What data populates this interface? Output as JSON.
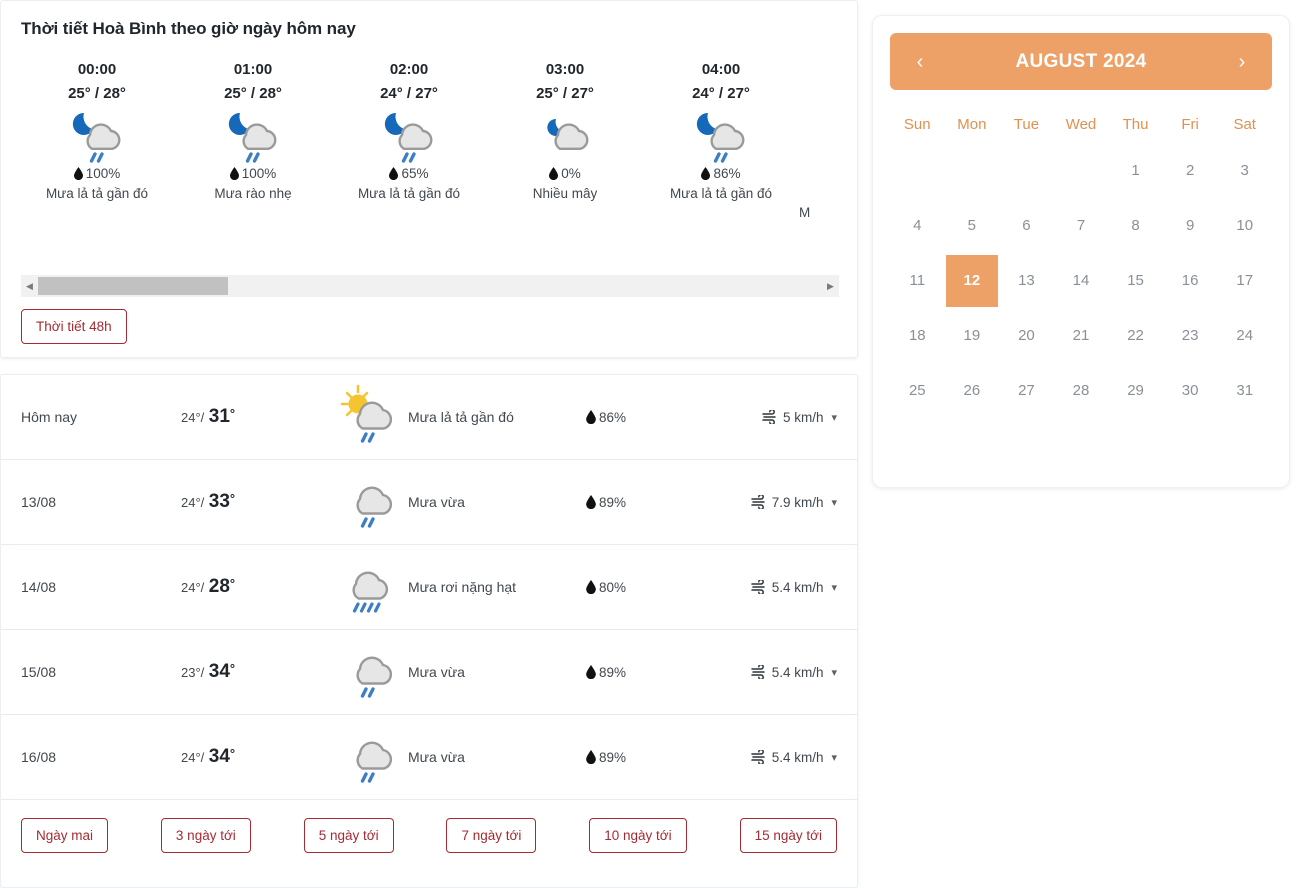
{
  "hourly": {
    "title": "Thời tiết Hoà Bình theo giờ ngày hôm nay",
    "columns": [
      {
        "time": "00:00",
        "temp": "25° / 28°",
        "pop": "100%",
        "desc": "Mưa lả tả gần đó",
        "icon": "moon-cloud-rain-icon"
      },
      {
        "time": "01:00",
        "temp": "25° / 28°",
        "pop": "100%",
        "desc": "Mưa rào nhẹ",
        "icon": "moon-cloud-rain-icon"
      },
      {
        "time": "02:00",
        "temp": "24° / 27°",
        "pop": "65%",
        "desc": "Mưa lả tả gần đó",
        "icon": "moon-cloud-rain-icon"
      },
      {
        "time": "03:00",
        "temp": "25° / 27°",
        "pop": "0%",
        "desc": "Nhiều mây",
        "icon": "moon-cloud-icon"
      },
      {
        "time": "04:00",
        "temp": "24° / 27°",
        "pop": "86%",
        "desc": "Mưa lả tả gần đó",
        "icon": "moon-cloud-rain-icon"
      }
    ],
    "cutoff_text": "M",
    "scroll": {
      "left_arrow": "◀",
      "right_arrow": "▶"
    },
    "button_48h": "Thời tiết 48h"
  },
  "daily": {
    "rows": [
      {
        "day": "Hôm nay",
        "low": "24°",
        "sep": "/",
        "high": "31",
        "deg": "°",
        "condition": "Mưa lả tả gần đó",
        "humidity": "86%",
        "wind": "5 km/h",
        "icon": "sun-cloud-rain-icon"
      },
      {
        "day": "13/08",
        "low": "24°",
        "sep": "/",
        "high": "33",
        "deg": "°",
        "condition": "Mưa vừa",
        "humidity": "89%",
        "wind": "7.9 km/h",
        "icon": "cloud-rain-icon"
      },
      {
        "day": "14/08",
        "low": "24°",
        "sep": "/",
        "high": "28",
        "deg": "°",
        "condition": "Mưa rơi nặng hạt",
        "humidity": "80%",
        "wind": "5.4 km/h",
        "icon": "cloud-heavy-rain-icon"
      },
      {
        "day": "15/08",
        "low": "23°",
        "sep": "/",
        "high": "34",
        "deg": "°",
        "condition": "Mưa vừa",
        "humidity": "89%",
        "wind": "5.4 km/h",
        "icon": "cloud-rain-icon"
      },
      {
        "day": "16/08",
        "low": "24°",
        "sep": "/",
        "high": "34",
        "deg": "°",
        "condition": "Mưa vừa",
        "humidity": "89%",
        "wind": "5.4 km/h",
        "icon": "cloud-rain-icon"
      }
    ],
    "range_buttons": [
      "Ngày mai",
      "3 ngày tới",
      "5 ngày tới",
      "7 ngày tới",
      "10 ngày tới",
      "15 ngày tới"
    ]
  },
  "calendar": {
    "title": "AUGUST 2024",
    "prev": "‹",
    "next": "›",
    "weekdays": [
      "Sun",
      "Mon",
      "Tue",
      "Wed",
      "Thu",
      "Fri",
      "Sat"
    ],
    "leading_blanks": 4,
    "days": [
      1,
      2,
      3,
      4,
      5,
      6,
      7,
      8,
      9,
      10,
      11,
      12,
      13,
      14,
      15,
      16,
      17,
      18,
      19,
      20,
      21,
      22,
      23,
      24,
      25,
      26,
      27,
      28,
      29,
      30,
      31
    ],
    "selected_day": 12
  },
  "colors": {
    "accent_orange": "#EDA166",
    "button_red": "#A42B33",
    "rain_blue": "#3C7FC4",
    "moon_blue": "#1668B8",
    "sun_yellow": "#F5C531",
    "cloud_gray": "#E3E3E3"
  }
}
